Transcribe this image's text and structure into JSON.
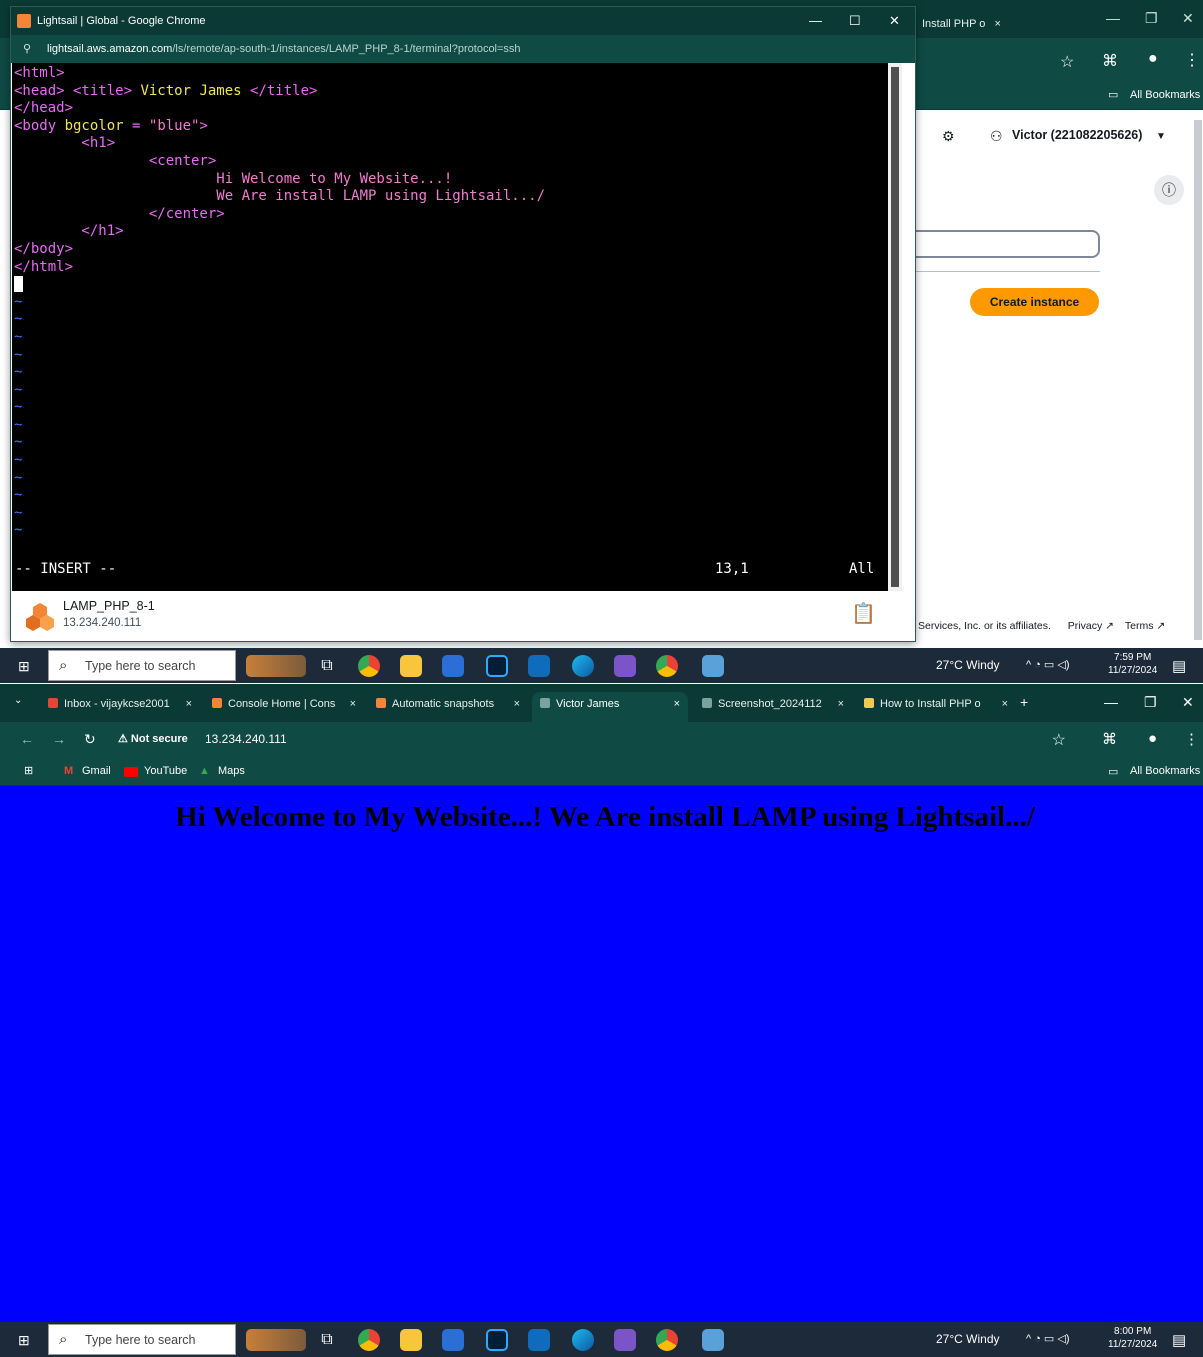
{
  "top": {
    "popup": {
      "title": "Lightsail | Global - Google Chrome",
      "url_host": "lightsail.aws.amazon.com",
      "url_path": "/ls/remote/ap-south-1/instances/LAMP_PHP_8-1/terminal?protocol=ssh",
      "terminal_lines": [
        {
          "segs": [
            [
              "tag",
              "<html>"
            ]
          ]
        },
        {
          "segs": [
            [
              "tag",
              "<head> <title> "
            ],
            [
              "attr",
              "Victor James"
            ],
            [
              "tag",
              " </title>"
            ]
          ]
        },
        {
          "segs": [
            [
              "tag",
              "</head>"
            ]
          ]
        },
        {
          "segs": [
            [
              "tag",
              "<body "
            ],
            [
              "attr",
              "bgcolor"
            ],
            [
              "tag",
              " = "
            ],
            [
              "str",
              "\"blue\""
            ],
            [
              "tag",
              ">"
            ]
          ]
        },
        {
          "segs": [
            [
              "tag",
              "        <h1>"
            ]
          ]
        },
        {
          "segs": [
            [
              "tag",
              "                <center>"
            ]
          ]
        },
        {
          "segs": [
            [
              "txt",
              "                        Hi Welcome to My Website...!"
            ]
          ]
        },
        {
          "segs": [
            [
              "txt",
              "                        We Are install LAMP using Lightsail.../"
            ]
          ]
        },
        {
          "segs": [
            [
              "tag",
              "                </center>"
            ]
          ]
        },
        {
          "segs": [
            [
              "tag",
              "        </h1>"
            ]
          ]
        },
        {
          "segs": [
            [
              "tag",
              "</body>"
            ]
          ]
        },
        {
          "segs": [
            [
              "tag",
              "</html>"
            ]
          ]
        }
      ],
      "tilde": "~",
      "tilde_count": 14,
      "status_mode": "-- INSERT --",
      "status_pos": "13,1",
      "status_scroll": "All",
      "instance_name": "LAMP_PHP_8-1",
      "instance_ip": "13.234.240.111"
    },
    "bg": {
      "tab_label": "Install PHP o",
      "tab_close": "×",
      "tab_new": "+",
      "bookmarks_all": "All Bookmarks",
      "user": "Victor (221082205626)",
      "create_button": "Create instance",
      "footer": "Services, Inc. or its affiliates.",
      "privacy": "Privacy",
      "terms": "Terms"
    },
    "taskbar": {
      "search_placeholder": "Type here to search",
      "temp": "27°C  Windy",
      "time": "7:59 PM",
      "date": "11/27/2024"
    }
  },
  "bottom": {
    "tabs": [
      {
        "label": "Inbox - vijaykcse2001",
        "close": "×"
      },
      {
        "label": "Console Home | Cons",
        "close": "×"
      },
      {
        "label": "Automatic snapshots",
        "close": "×"
      },
      {
        "label": "Victor James",
        "close": "×"
      },
      {
        "label": "Screenshot_2024112",
        "close": "×"
      },
      {
        "label": "How to Install PHP o",
        "close": "×"
      }
    ],
    "new_tab": "+",
    "not_secure": "Not secure",
    "url": "13.234.240.111",
    "bookmarks": [
      "Gmail",
      "YouTube",
      "Maps"
    ],
    "bookmarks_all": "All Bookmarks",
    "heading": "Hi Welcome to My Website...! We Are install LAMP using Lightsail.../",
    "page_bg_color": "#0000ff",
    "taskbar": {
      "search_placeholder": "Type here to search",
      "temp": "27°C  Windy",
      "time": "8:00 PM",
      "date": "11/27/2024"
    }
  },
  "colors": {
    "chrome_dark": "#0b3a36",
    "chrome_mid": "#0f4a44",
    "aws_orange": "#ff9900"
  }
}
